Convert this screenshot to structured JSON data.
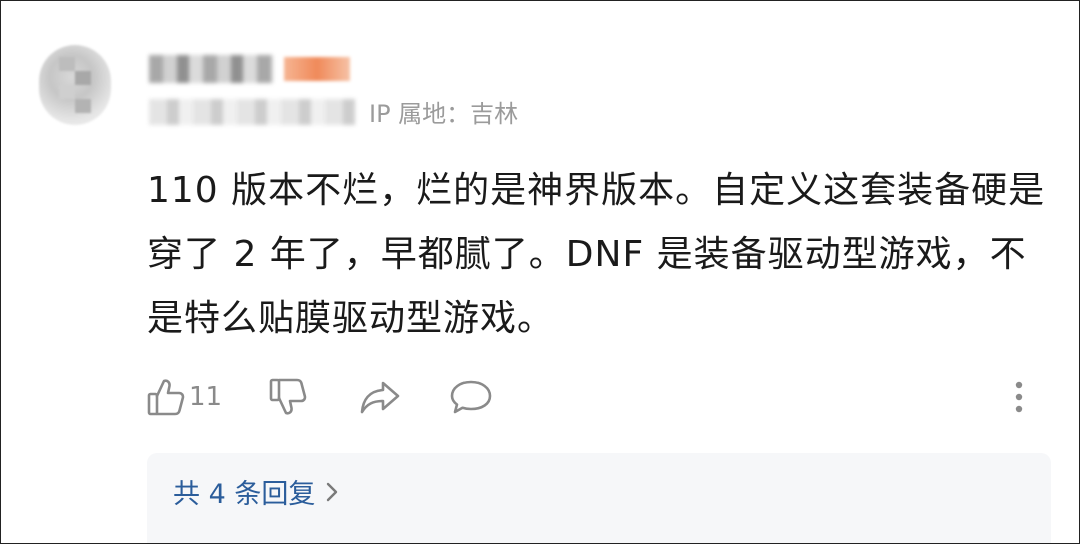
{
  "comment": {
    "ip_location": "IP 属地：吉林",
    "text_lines": [
      "110 版本不烂，烂的是神界版本。自定义这套装备硬是",
      "穿了 2 年了，早都腻了。DNF 是装备驱动型游戏，不",
      "是特么贴膜驱动型游戏。"
    ]
  },
  "actions": {
    "like_count": "11",
    "icons": [
      "thumbs-up-icon",
      "thumbs-down-icon",
      "share-icon",
      "comment-icon",
      "more-vertical-icon"
    ]
  },
  "replies": {
    "label": "共 4 条回复",
    "chevron": "chevron-right-icon"
  },
  "colors": {
    "text": "#1a1a1a",
    "meta": "#9b9b9b",
    "icon": "#8a8a8a",
    "link": "#2b5d9b",
    "reply_bg": "#f6f7f9"
  }
}
